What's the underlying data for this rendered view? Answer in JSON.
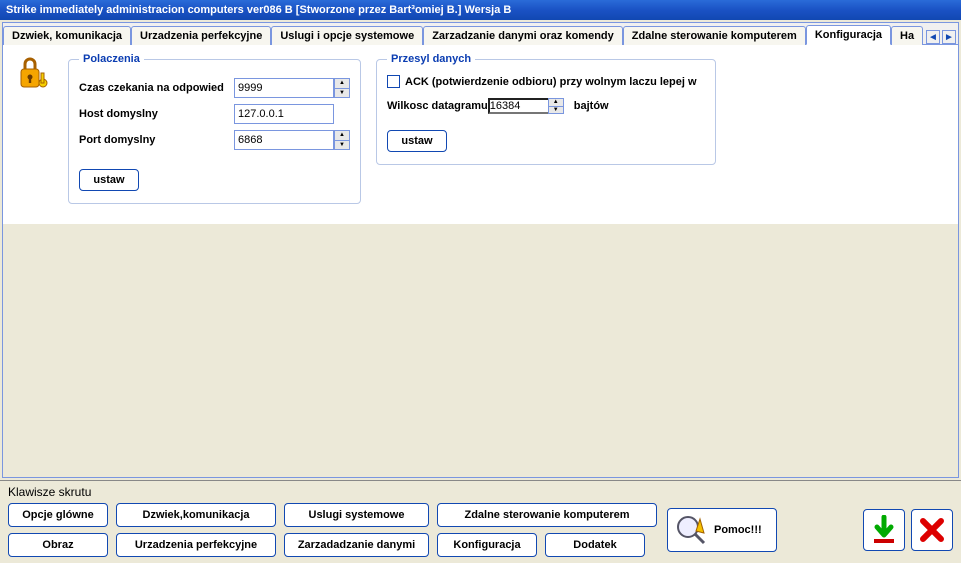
{
  "window": {
    "title": "Strike immediately administracion computers ver086 B [Stworzone przez Bart³omiej B.] Wersja B"
  },
  "tabs": [
    {
      "label": "Dzwiek, komunikacja"
    },
    {
      "label": "Urzadzenia perfekcyjne"
    },
    {
      "label": "Uslugi i opcje systemowe"
    },
    {
      "label": "Zarzadzanie danymi oraz komendy"
    },
    {
      "label": "Zdalne sterowanie komputerem"
    },
    {
      "label": "Konfiguracja"
    },
    {
      "label": "Ha"
    }
  ],
  "active_tab_index": 5,
  "connections": {
    "legend": "Polaczenia",
    "timeout_label": "Czas czekania na odpowied",
    "timeout_value": "9999",
    "host_label": "Host domyslny",
    "host_value": "127.0.0.1",
    "port_label": "Port domyslny",
    "port_value": "6868",
    "set_button": "ustaw"
  },
  "transfer": {
    "legend": "Przesyl danych",
    "ack_label": "ACK (potwierdzenie odbioru) przy wolnym laczu lepej w",
    "datagram_label": "Wilkosc datagramu",
    "datagram_value": "16384",
    "datagram_unit": "bajtów",
    "set_button": "ustaw"
  },
  "shortcuts": {
    "title": "Klawisze skrutu",
    "buttons": {
      "main_options": "Opcje glówne",
      "sound_comm": "Dzwiek,komunikacja",
      "sys_services": "Uslugi systemowe",
      "remote_control": "Zdalne sterowanie komputerem",
      "image": "Obraz",
      "devices": "Urzadzenia perfekcyjne",
      "data_mgmt": "Zarzadadzanie danymi",
      "configuration": "Konfiguracja",
      "addon": "Dodatek"
    },
    "help_label": "Pomoc!!!"
  }
}
